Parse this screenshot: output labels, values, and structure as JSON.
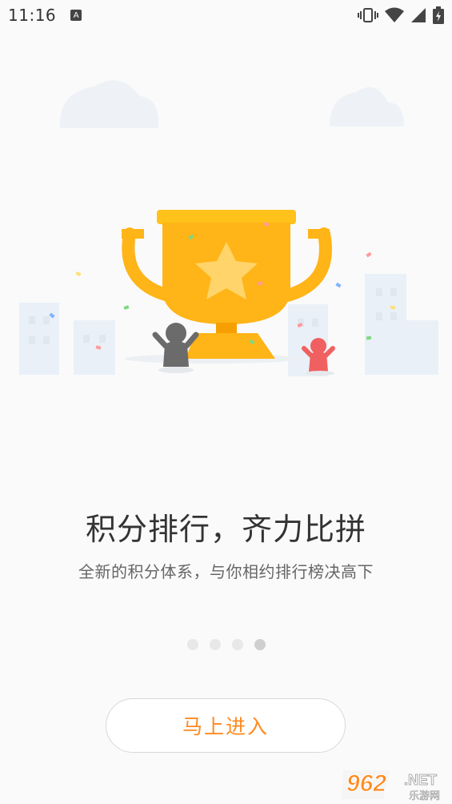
{
  "status_bar": {
    "time": "11:16",
    "notification_icon": "A",
    "icons": [
      "vibrate-icon",
      "wifi-icon",
      "signal-icon",
      "battery-charging-icon"
    ]
  },
  "illustration": {
    "icons": [
      "cloud-icon",
      "trophy-icon",
      "star-icon",
      "buildings-icon",
      "person-icon",
      "confetti-icon"
    ],
    "colors": {
      "trophy": "#ffb417",
      "trophy_dark": "#f5a000",
      "person_gray": "#6b6b6b",
      "person_red": "#f06060"
    }
  },
  "main": {
    "title": "积分排行，齐力比拼",
    "subtitle": "全新的积分体系，与你相约排行榜决高下"
  },
  "pagination": {
    "count": 4,
    "active_index": 3
  },
  "enter_button": {
    "label": "马上进入"
  },
  "accent_color": "#ff8a1f",
  "watermark": {
    "number": "962",
    "suffix": ".NET",
    "subtitle": "乐游网"
  }
}
